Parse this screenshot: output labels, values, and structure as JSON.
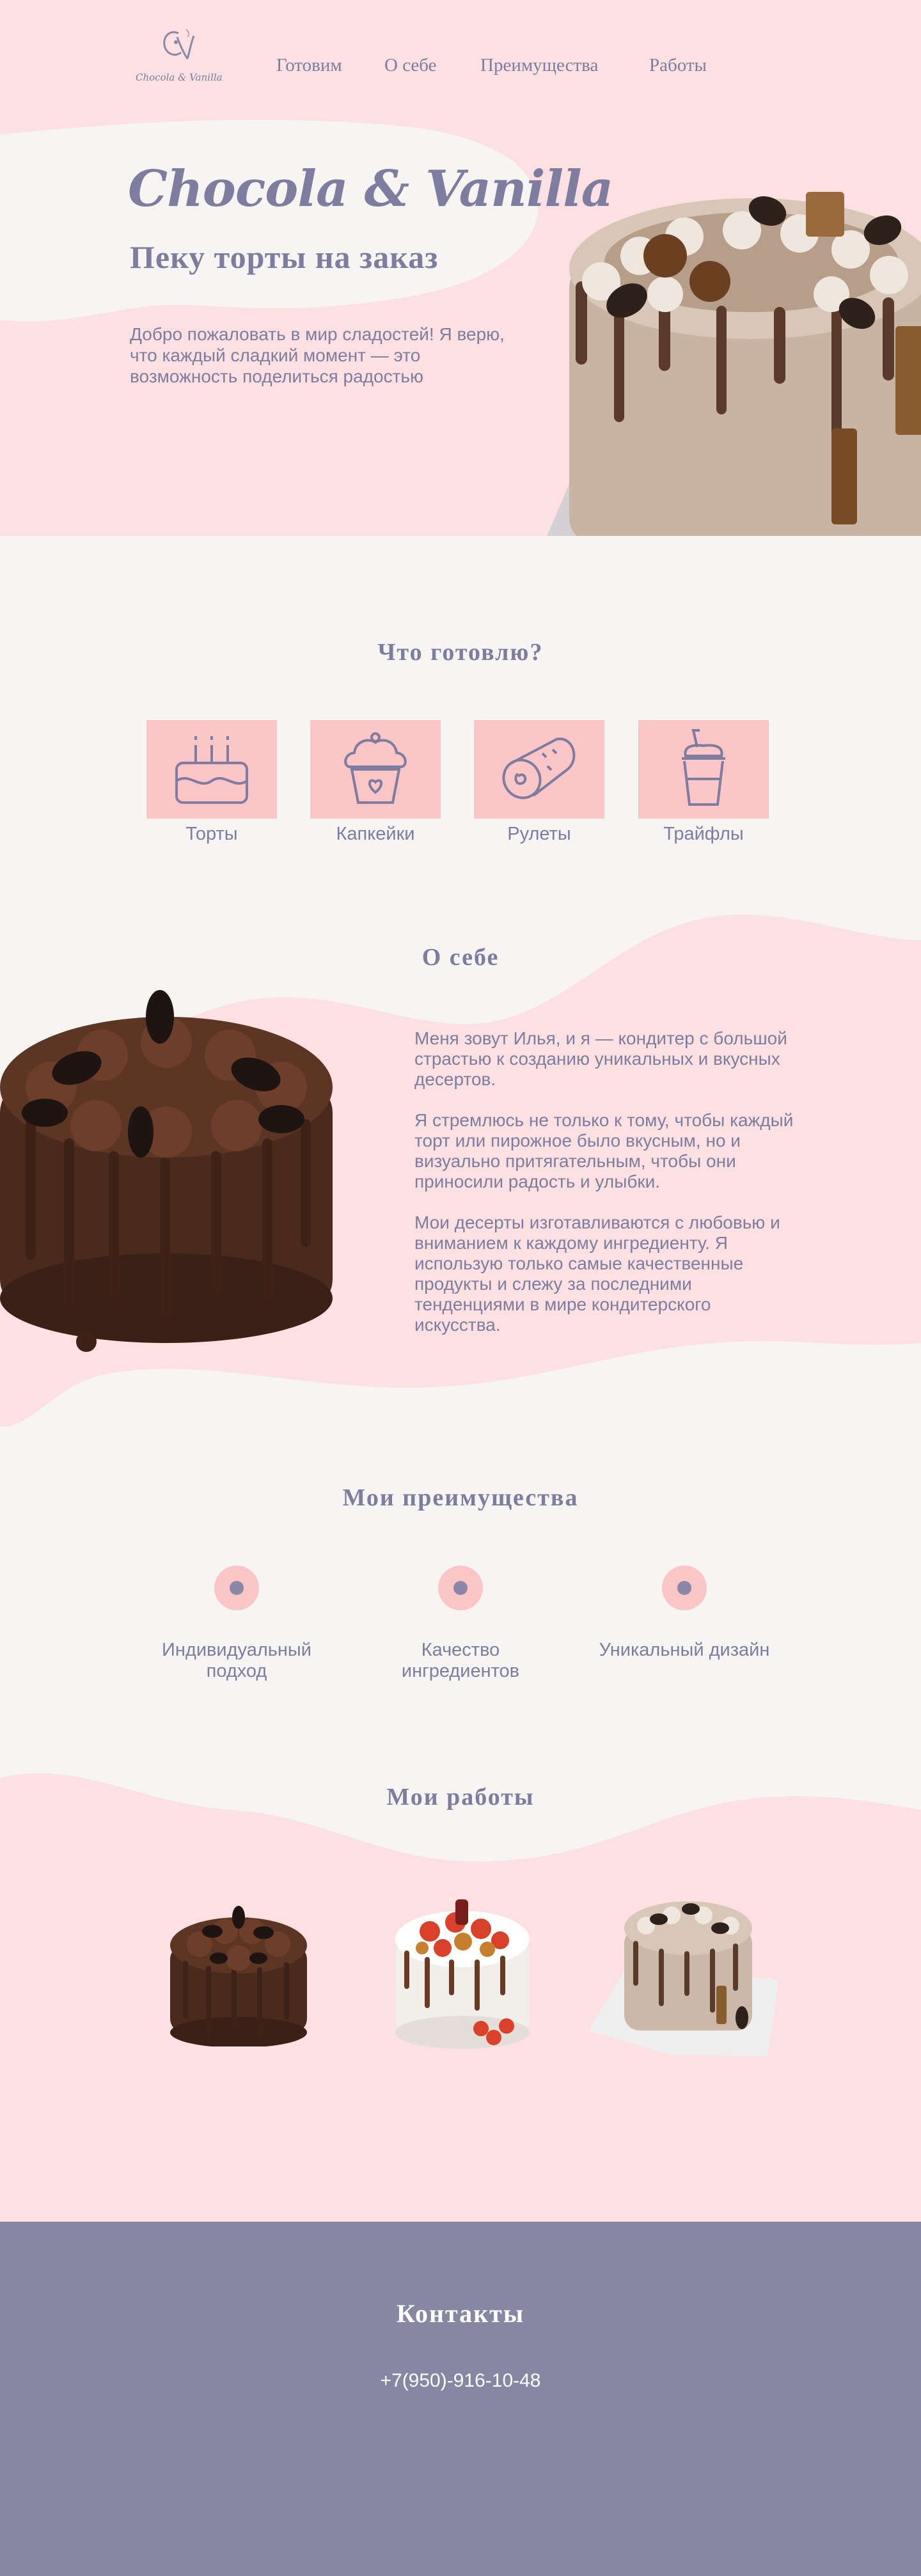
{
  "brand": {
    "name": "Chocola & Vanilla",
    "logo_text": "Chocola & Vanilla"
  },
  "nav": [
    {
      "label": "Готовим"
    },
    {
      "label": "О себе"
    },
    {
      "label": "Преимущества"
    },
    {
      "label": "Работы"
    }
  ],
  "hero": {
    "title": "Chocola & Vanilla",
    "subtitle": "Пеку торты на заказ",
    "text": "Добро пожаловать в мир сладостей! Я верю, что каждый сладкий момент — это возможность поделиться радостью"
  },
  "cook": {
    "title": "Что готовлю?",
    "items": [
      {
        "label": "Торты",
        "icon": "cake-icon"
      },
      {
        "label": "Капкейки",
        "icon": "cupcake-icon"
      },
      {
        "label": "Рулеты",
        "icon": "roll-icon"
      },
      {
        "label": "Трайфлы",
        "icon": "trifle-icon"
      }
    ]
  },
  "about": {
    "title": "О себе",
    "paragraphs": [
      "Меня зовут Илья, и я — кондитер с большой страстью к созданию уникальных и вкусных десертов.",
      "Я стремлюсь не только к тому, чтобы каждый торт или пирожное было вкусным, но и визуально притягательным, чтобы они приносили радость и улыбки.",
      "Мои десерты изготавливаются с любовью и вниманием к каждому ингредиенту. Я использую только самые качественные продукты и слежу за последними тенденциями в мире кондитерского искусства."
    ]
  },
  "advantages": {
    "title": "Мои преимущества",
    "items": [
      {
        "label": "Индивидуальный подход"
      },
      {
        "label": "Качество ингредиентов"
      },
      {
        "label": "Уникальный дизайн"
      }
    ]
  },
  "works": {
    "title": "Мои работы"
  },
  "contacts": {
    "title": "Контакты",
    "phone": "+7(950)-916-10-48"
  },
  "colors": {
    "pink_bg": "#fde0e1",
    "pink_box": "#fcc5c7",
    "text_purple": "#7e7c9f",
    "page_bg": "#f7f5f3",
    "footer_bg": "#8887a3"
  }
}
